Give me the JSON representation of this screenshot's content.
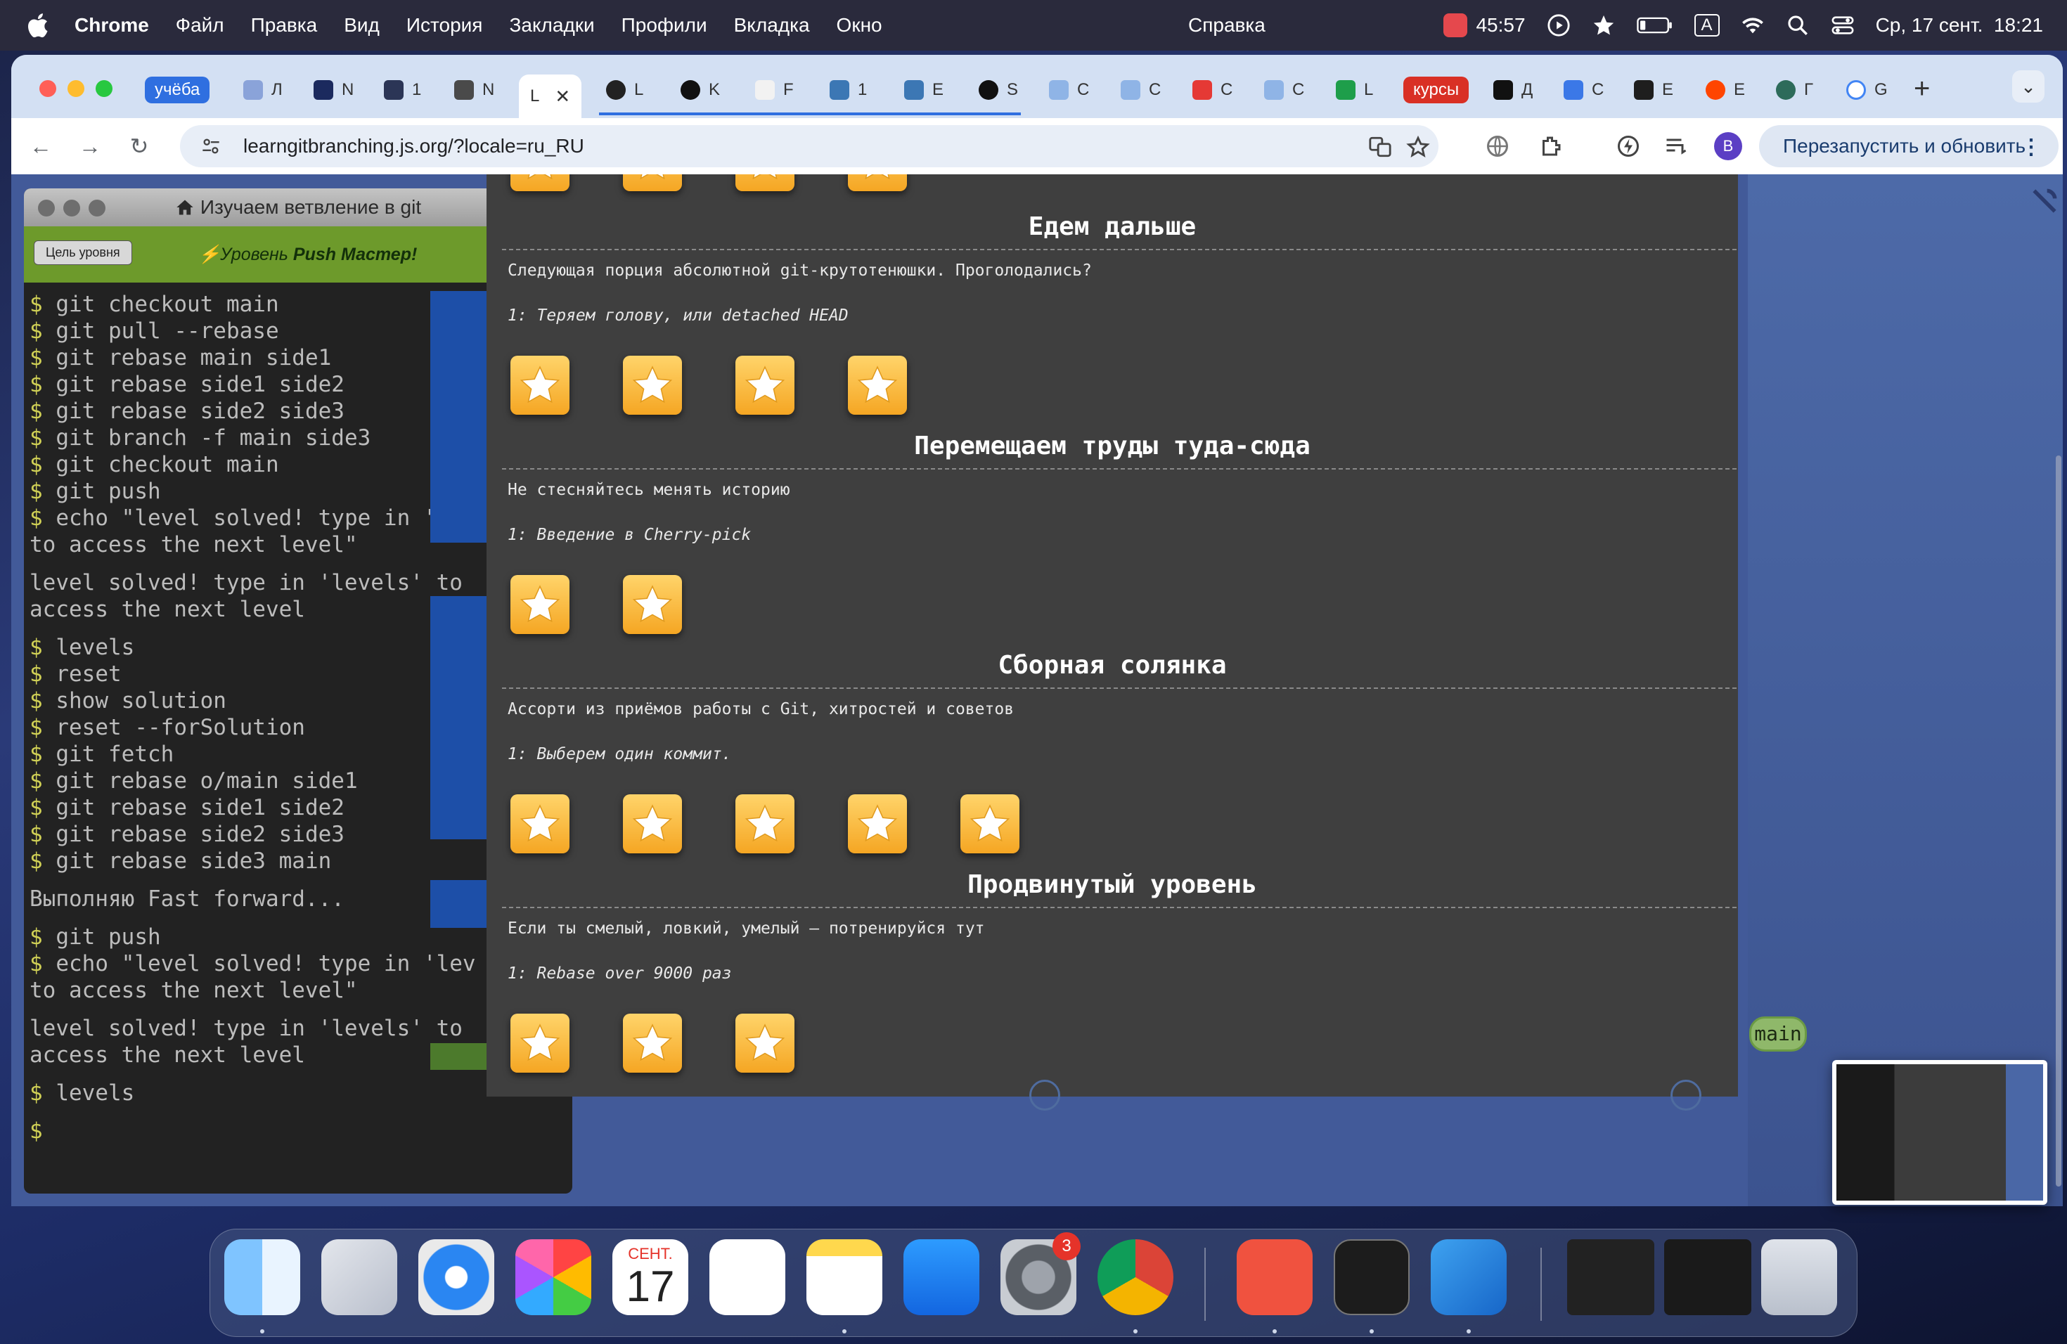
{
  "menubar": {
    "app_name": "Chrome",
    "items": [
      "Файл",
      "Правка",
      "Вид",
      "История",
      "Закладки",
      "Профили",
      "Вкладка",
      "Окно"
    ],
    "help": "Справка",
    "timer": "45:57",
    "input_source": "A",
    "datetime": "Ср, 17 сент.  18:21"
  },
  "browser": {
    "tab_group_label": "учёба",
    "active_tab_title": "L",
    "tab_group_red_label": "курсы",
    "tab_letters": [
      "Л",
      "N",
      "1",
      "N",
      "L",
      "K",
      "F",
      "1",
      "E",
      "S",
      "C",
      "C",
      "C",
      "C",
      "L",
      "Д",
      "C",
      "E",
      "E",
      "Г",
      "G"
    ],
    "url": "learngitbranching.js.org/?locale=ru_RU",
    "relaunch_label": "Перезапустить и обновить",
    "profile_initial": "B"
  },
  "terminal": {
    "title": "Изучаем ветвление в git",
    "goal_button": "Цель уровня",
    "level_prefix": "Уровень ",
    "level_name": "Push Мастер!",
    "prompt": "$",
    "block1": [
      "git checkout main",
      "git pull --rebase",
      "git rebase main side1",
      "git rebase side1 side2",
      "git rebase side2 side3",
      "git branch -f main side3",
      "git checkout main",
      "git push",
      "echo \"level solved! type in 'lev"
    ],
    "block1_cont": "to access the next level\"",
    "msg1a": "level solved! type in 'levels' to",
    "msg1b": "access the next level",
    "block2": [
      "levels",
      "reset",
      "show solution",
      "reset --forSolution",
      "git fetch",
      "git rebase o/main side1",
      "git rebase side1 side2",
      "git rebase side2 side3",
      "git rebase side3 main"
    ],
    "fast_forward": "Выполняю Fast forward...",
    "block3": [
      "git push",
      "echo \"level solved! type in 'lev"
    ],
    "block3_cont": "to access the next level\"",
    "msg2a": "level solved! type in 'levels' to",
    "msg2b": "access the next level",
    "last_cmd": "levels"
  },
  "levels_panel": {
    "sections": [
      {
        "title": "Едем дальше",
        "description": "Следующая порция абсолютной git-крутотенюшки. Проголодались?",
        "subtitle": "1: Теряем голову, или detached HEAD",
        "stars": 4
      },
      {
        "title": "Перемещаем труды туда-сюда",
        "description": "Не стесняйтесь менять историю",
        "subtitle": "1: Введение в Cherry-pick",
        "stars": 2
      },
      {
        "title": "Сборная солянка",
        "description": "Ассорти из приёмов работы с Git, хитростей и советов",
        "subtitle": "1: Выберем один коммит.",
        "stars": 5
      },
      {
        "title": "Продвинутый уровень",
        "description": "Если ты смелый, ловкий, умелый – потренируйся тут",
        "subtitle": "1: Rebase over 9000 раз",
        "stars": 3
      }
    ]
  },
  "graph": {
    "branch_label": "main"
  },
  "dock": {
    "calendar_month": "СЕНТ.",
    "calendar_day": "17",
    "settings_badge": "3"
  },
  "colors": {
    "accent": "#2f6fe0",
    "panel_bg": "#3f3f3f",
    "terminal_bg": "#222222",
    "goal_bar": "#6d9a2b",
    "star": "#f5a623"
  }
}
